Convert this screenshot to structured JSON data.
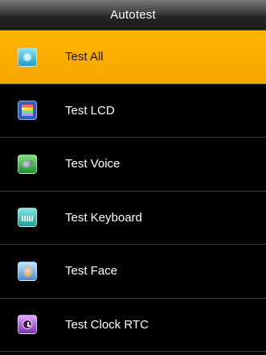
{
  "window": {
    "title": "Autotest"
  },
  "menu": {
    "items": [
      {
        "label": "Test All",
        "icon": "test-all-icon",
        "selected": true
      },
      {
        "label": "Test LCD",
        "icon": "lcd-icon",
        "selected": false
      },
      {
        "label": "Test Voice",
        "icon": "speaker-icon",
        "selected": false
      },
      {
        "label": "Test Keyboard",
        "icon": "keyboard-icon",
        "selected": false
      },
      {
        "label": "Test Face",
        "icon": "face-icon",
        "selected": false
      },
      {
        "label": "Test Clock RTC",
        "icon": "clock-icon",
        "selected": false
      }
    ]
  },
  "colors": {
    "background": "#000000",
    "selected": "#f7a600",
    "text": "#ffffff",
    "divider": "#3a3a3a"
  }
}
